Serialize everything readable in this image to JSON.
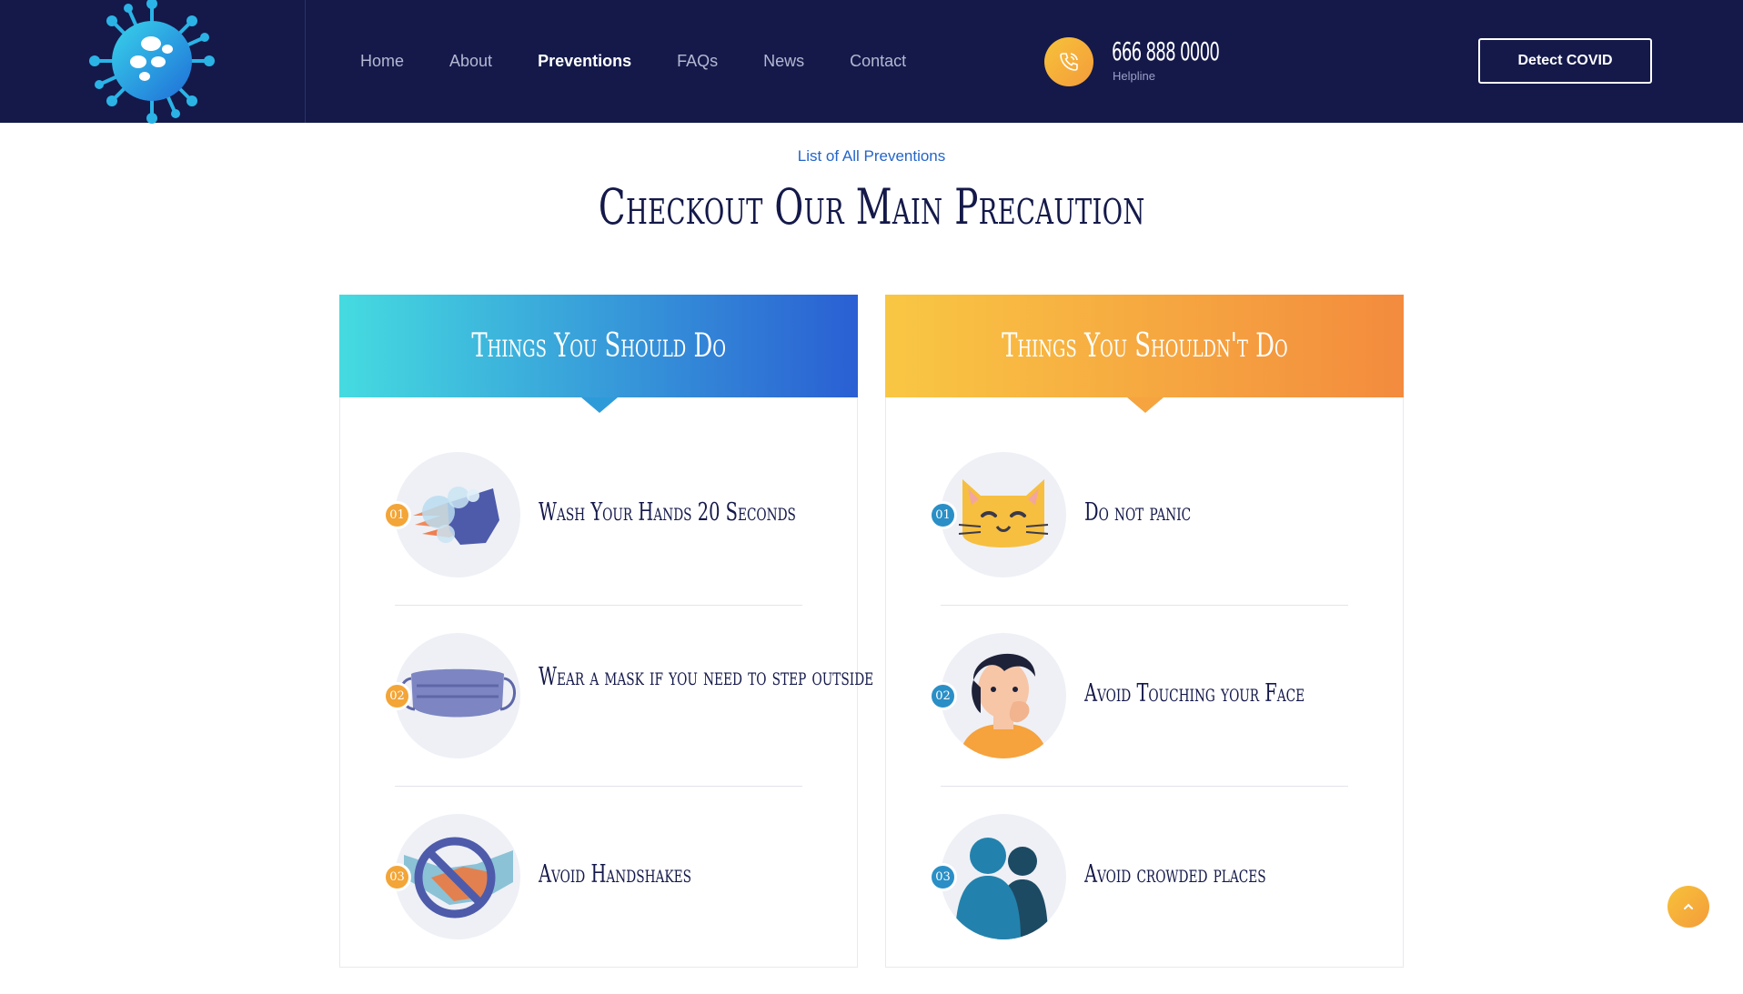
{
  "nav": {
    "items": [
      {
        "label": "Home",
        "active": false
      },
      {
        "label": "About",
        "active": false
      },
      {
        "label": "Preventions",
        "active": true
      },
      {
        "label": "FAQs",
        "active": false
      },
      {
        "label": "News",
        "active": false
      },
      {
        "label": "Contact",
        "active": false
      }
    ]
  },
  "helpline": {
    "number": "666 888 0000",
    "label": "Helpline",
    "icon": "phone-icon"
  },
  "header_button": {
    "label": "Detect COVID"
  },
  "section": {
    "subtitle": "List of All Preventions",
    "title": "Checkout Our Main Precaution"
  },
  "cards": {
    "do": {
      "title": "Things You Should Do",
      "gradient": [
        "#45dbe0",
        "#2a5fd3"
      ],
      "badge_color": "#f3a537",
      "items": [
        {
          "number": "01",
          "text": "Wash Your Hands 20 Seconds",
          "icon": "hand-washing-icon"
        },
        {
          "number": "02",
          "text": "Wear a mask if you need to step outside",
          "icon": "face-mask-icon"
        },
        {
          "number": "03",
          "text": "Avoid Handshakes",
          "icon": "no-handshake-icon"
        }
      ]
    },
    "dont": {
      "title": "Things You Shouldn't Do",
      "gradient": [
        "#f9c743",
        "#f38b3e"
      ],
      "badge_color": "#2a8fc6",
      "items": [
        {
          "number": "01",
          "text": "Do not panic",
          "icon": "calm-cat-icon"
        },
        {
          "number": "02",
          "text": "Avoid Touching your Face",
          "icon": "touching-face-icon"
        },
        {
          "number": "03",
          "text": "Avoid crowded places",
          "icon": "crowd-icon"
        }
      ]
    }
  },
  "colors": {
    "header_bg": "#14194a",
    "accent_blue": "#2465c9",
    "accent_orange": "#f49c3a"
  }
}
